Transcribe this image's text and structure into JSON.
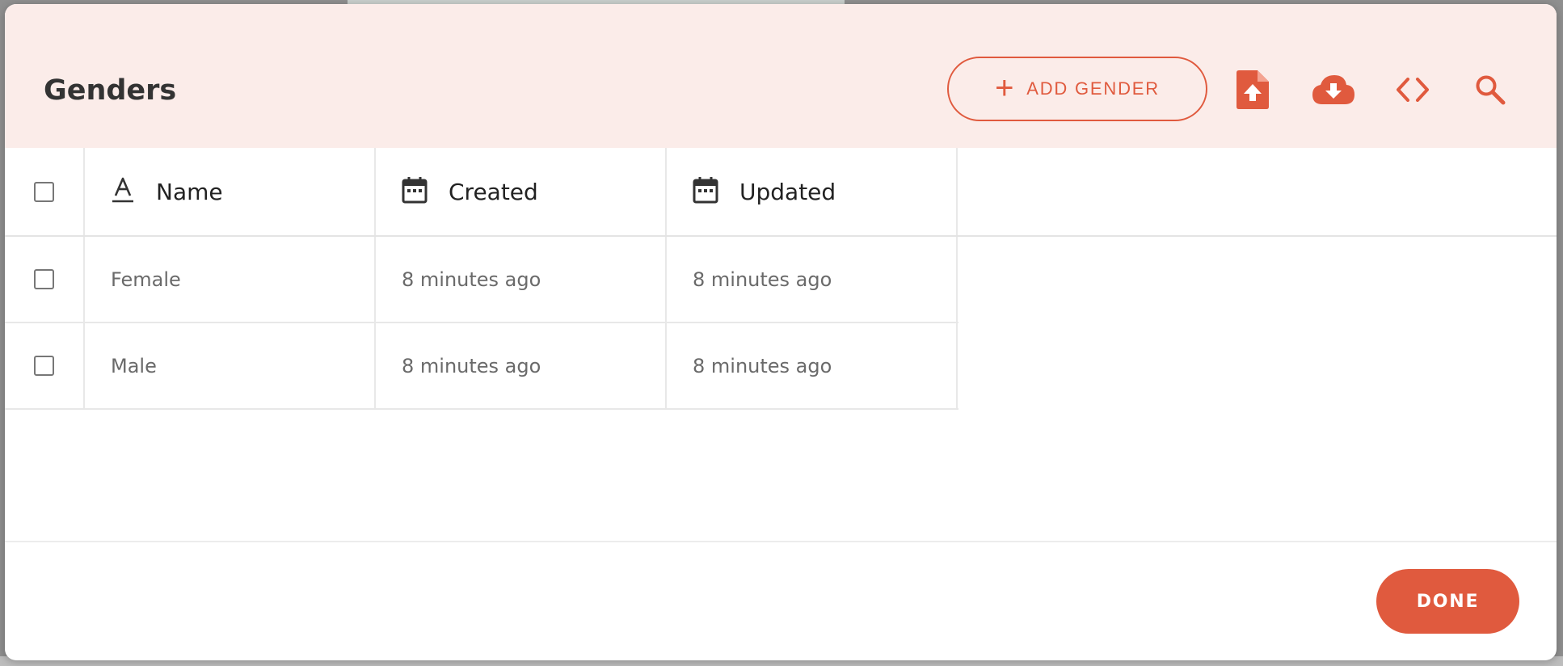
{
  "dialog": {
    "title": "Genders",
    "add_button_label": "ADD GENDER",
    "done_button_label": "DONE",
    "header_icons": [
      "file-upload-icon",
      "cloud-download-icon",
      "code-icon",
      "search-icon"
    ]
  },
  "table": {
    "columns": [
      {
        "label": "Name",
        "icon": "text-format-icon"
      },
      {
        "label": "Created",
        "icon": "calendar-icon"
      },
      {
        "label": "Updated",
        "icon": "calendar-icon"
      }
    ],
    "rows": [
      {
        "name": "Female",
        "created": "8 minutes ago",
        "updated": "8 minutes ago",
        "checked": false
      },
      {
        "name": "Male",
        "created": "8 minutes ago",
        "updated": "8 minutes ago",
        "checked": false
      }
    ]
  },
  "colors": {
    "accent": "#e05a3e",
    "header_background": "#fbece9",
    "text_primary": "#333333",
    "text_secondary": "#6a6a6a"
  }
}
